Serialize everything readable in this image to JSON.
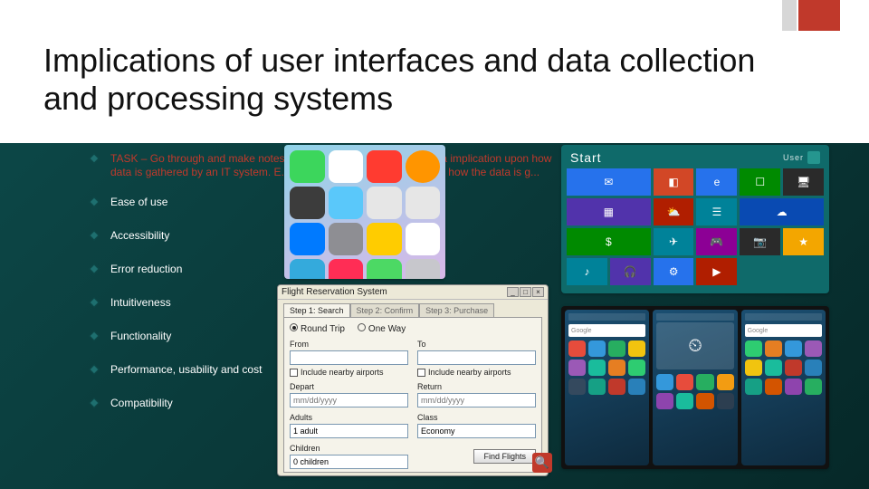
{
  "title": "Implications of user interfaces and data collection and processing systems",
  "task": "TASK – Go through and make notes on how each of these can have a implication upon how data is gathered by an IT system. E.g. Ease of Use – directly linked to how the data is g...",
  "bullets": [
    "Ease of use",
    "Accessibility",
    "Error reduction",
    "Intuitiveness",
    "Functionality",
    "Performance, usability and cost",
    "Compatibility"
  ],
  "win": {
    "heading": "Start",
    "user": "User"
  },
  "dialog": {
    "title": "Flight Reservation System",
    "tabs": [
      "Step 1: Search",
      "Step 2: Confirm",
      "Step 3: Purchase"
    ],
    "radio_round": "Round Trip",
    "radio_oneway": "One Way",
    "from_label": "From",
    "to_label": "To",
    "nearby": "Include nearby airports",
    "depart_label": "Depart",
    "return_label": "Return",
    "date_placeholder": "mm/dd/yyyy",
    "adults_label": "Adults",
    "adults_value": "1 adult",
    "children_label": "Children",
    "children_value": "0 children",
    "class_label": "Class",
    "class_value": "Economy",
    "find": "Find Flights"
  },
  "android": {
    "search_placeholder": "Google"
  },
  "icons": {
    "magnifier": "�search"
  }
}
